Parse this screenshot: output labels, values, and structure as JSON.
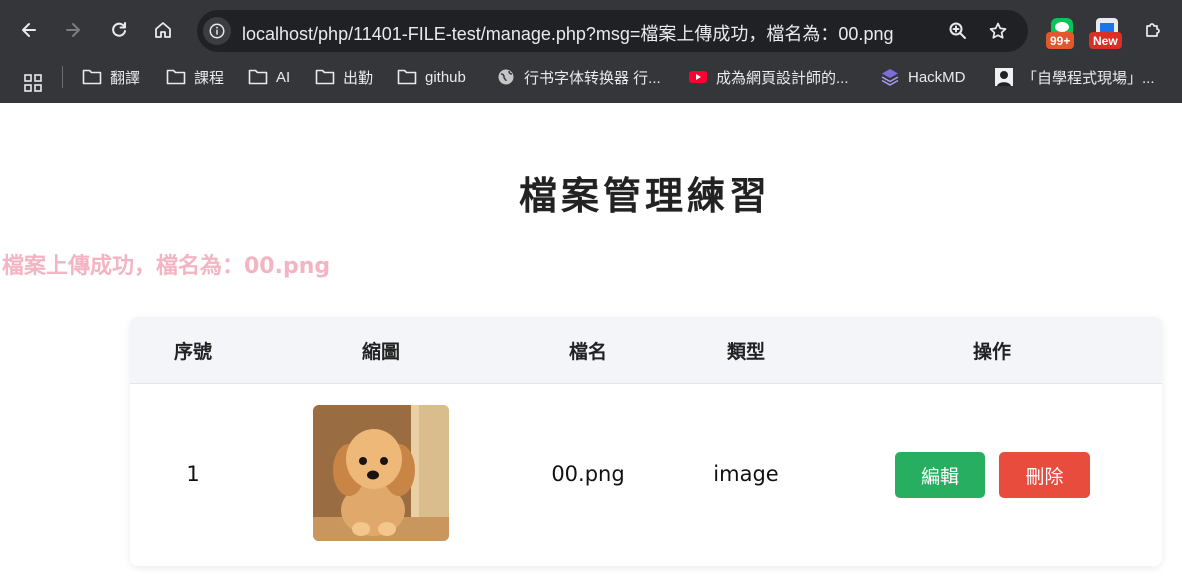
{
  "browser": {
    "url": "localhost/php/11401-FILE-test/manage.php?msg=檔案上傳成功，檔名為：00.png",
    "extensions": [
      {
        "name": "line-extension",
        "badge": "99+",
        "badge_color": "#e2572b"
      },
      {
        "name": "new-extension",
        "badge": "New",
        "badge_color": "#d93025"
      }
    ],
    "bookmarks": [
      {
        "label": "翻譯",
        "icon": "folder-icon"
      },
      {
        "label": "課程",
        "icon": "folder-icon"
      },
      {
        "label": "AI",
        "icon": "folder-icon"
      },
      {
        "label": "出勤",
        "icon": "folder-icon"
      },
      {
        "label": "github",
        "icon": "folder-icon"
      },
      {
        "label": "行书字体转换器 行...",
        "icon": "globe-icon"
      },
      {
        "label": "成為網頁設計師的...",
        "icon": "youtube-icon"
      },
      {
        "label": "HackMD",
        "icon": "hackmd-icon"
      },
      {
        "label": "「自學程式現場」...",
        "icon": "avatar-icon"
      }
    ]
  },
  "page": {
    "title": "檔案管理練習",
    "message": "檔案上傳成功，檔名為：00.png",
    "message_color": "#f4b4c4"
  },
  "table": {
    "headers": {
      "index": "序號",
      "thumbnail": "縮圖",
      "filename": "檔名",
      "type": "類型",
      "actions": "操作"
    },
    "rows": [
      {
        "index": "1",
        "thumbnail": "puppy-photo",
        "filename": "00.png",
        "type": "image",
        "edit_label": "編輯",
        "delete_label": "刪除"
      }
    ],
    "colors": {
      "edit": "#27ae60",
      "delete": "#e74c3c",
      "header_bg": "#f4f5f9"
    }
  }
}
